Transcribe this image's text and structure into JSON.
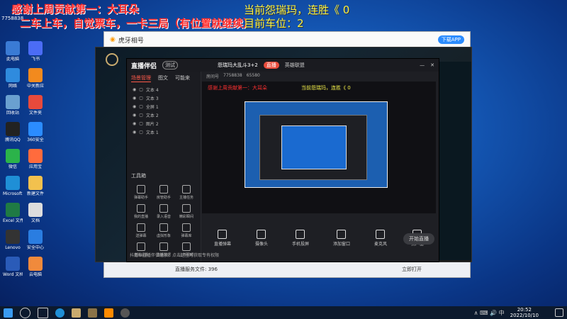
{
  "overlay": {
    "thanks": "感谢上周贡献第一：大耳朵",
    "rule": "二车上车，自觉票车，一卡三局（有位置就继续）",
    "hero_streak": "当前怨瑞玛，连胜《   0",
    "seat": "目前车位：2",
    "room_id": "7758838"
  },
  "desktop_icons": [
    {
      "label": "此电脑",
      "color": "#3a7bd5"
    },
    {
      "label": "飞书",
      "color": "#4b6cf5"
    },
    {
      "label": "网络",
      "color": "#2f8bde"
    },
    {
      "label": "中关新应",
      "color": "#f28a1e"
    },
    {
      "label": "回收站",
      "color": "#6aa0d0"
    },
    {
      "label": "文件夹",
      "color": "#e84a3c"
    },
    {
      "label": "腾讯QQ",
      "color": "#222"
    },
    {
      "label": "360安全",
      "color": "#2b8cff"
    },
    {
      "label": "微信",
      "color": "#2bb34a"
    },
    {
      "label": "应用宝",
      "color": "#ff6b3d"
    },
    {
      "label": "Microsoft Edge",
      "color": "#1f8fd6"
    },
    {
      "label": "新建文件",
      "color": "#f2c14e"
    },
    {
      "label": "Excel 文件",
      "color": "#1f7a44"
    },
    {
      "label": "文档",
      "color": "#ddd"
    },
    {
      "label": "Lenovo",
      "color": "#333"
    },
    {
      "label": "安全中心",
      "color": "#2a7de1"
    },
    {
      "label": "Word 文档",
      "color": "#2a5bb8"
    },
    {
      "label": "云电脑",
      "color": "#f08a3c"
    }
  ],
  "browser": {
    "title": "虎牙相号",
    "badge": "下载APP",
    "tab": "虎牙直播",
    "footer": "直播服务文件: 396",
    "footer_right": "立即打开"
  },
  "app": {
    "brand": "直播伴侣",
    "version": "测试",
    "stream_title": "怨瑞玛大乱斗3+2",
    "live_badge": "直播",
    "room_label": "房间号",
    "room": "7758838",
    "category": "英雄联盟",
    "fans": "65580",
    "side_tabs": [
      "场景管理",
      "图文",
      "可能来"
    ],
    "layers": [
      "文本 4",
      "文本 3",
      "全屏 1",
      "文本 2",
      "图片 2",
      "文本 1"
    ],
    "tools_title": "工具箱",
    "tools": [
      "弹幕助手",
      "房管助手",
      "主播任务",
      "我的直播",
      "录入语音",
      "精彩瞬间",
      "送弹幕",
      "虚拟形象",
      "弹幕库",
      "直播设置",
      "直播数据",
      "上传视频"
    ],
    "notice": "抖播以直播伴侣播放，点击这里可获取专有权限",
    "bottom_buttons": [
      "直播弹幕",
      "摄像头",
      "手机投屏",
      "添加窗口",
      "麦克风",
      "扬声器"
    ],
    "start_button": "开始直播"
  },
  "taskbar": {
    "time": "20:52",
    "date": "2022/10/10"
  }
}
